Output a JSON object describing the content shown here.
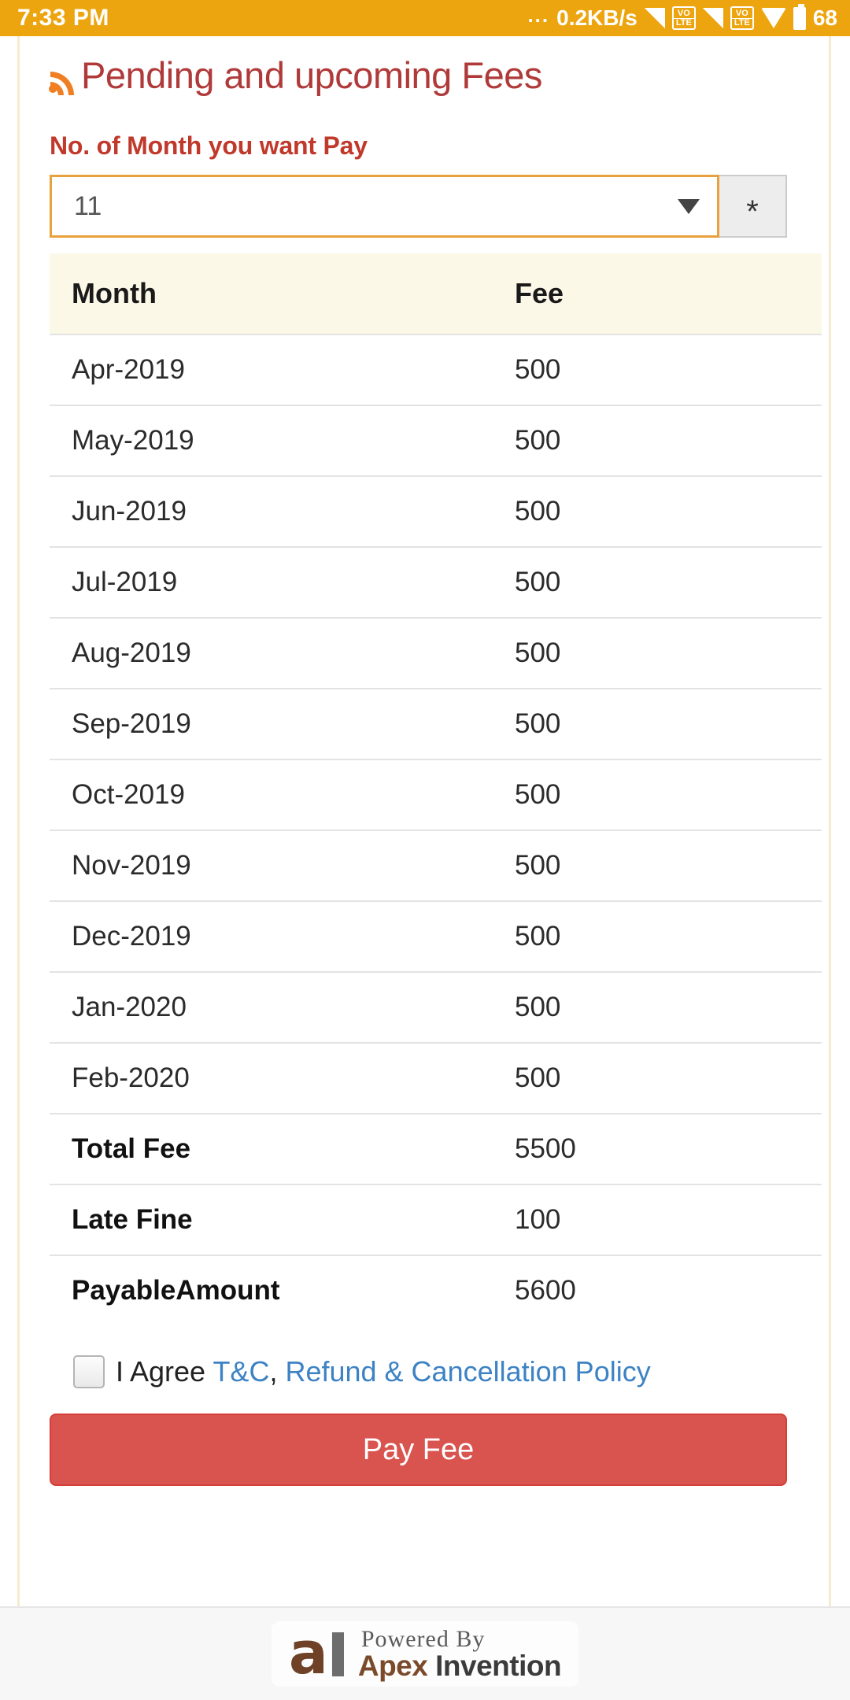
{
  "status_bar": {
    "time": "7:33 PM",
    "dots": "...",
    "data_rate": "0.2KB/s",
    "sim1_label_top": "VO",
    "sim1_label_bottom": "LTE",
    "sim2_label_top": "VO",
    "sim2_label_bottom": "LTE",
    "battery_percent": "68",
    "background_color": "#eda50f"
  },
  "header": {
    "icon": "rss-icon",
    "title": "Pending and upcoming Fees",
    "title_color": "#b03a3a",
    "icon_color": "#f07e22"
  },
  "form": {
    "label": "No. of Month you want Pay",
    "label_color": "#c0392b",
    "select_value": "11",
    "select_border_color": "#e8a13c",
    "caret_icon": "chevron-down-icon",
    "required_marker": "*"
  },
  "table": {
    "columns": [
      "Month",
      "Fee"
    ],
    "header_background": "#fbf8e8",
    "rows": [
      {
        "month": "Apr-2019",
        "fee": "500",
        "bold": false
      },
      {
        "month": "May-2019",
        "fee": "500",
        "bold": false
      },
      {
        "month": "Jun-2019",
        "fee": "500",
        "bold": false
      },
      {
        "month": "Jul-2019",
        "fee": "500",
        "bold": false
      },
      {
        "month": "Aug-2019",
        "fee": "500",
        "bold": false
      },
      {
        "month": "Sep-2019",
        "fee": "500",
        "bold": false
      },
      {
        "month": "Oct-2019",
        "fee": "500",
        "bold": false
      },
      {
        "month": "Nov-2019",
        "fee": "500",
        "bold": false
      },
      {
        "month": "Dec-2019",
        "fee": "500",
        "bold": false
      },
      {
        "month": "Jan-2020",
        "fee": "500",
        "bold": false
      },
      {
        "month": "Feb-2020",
        "fee": "500",
        "bold": false
      },
      {
        "month": "Total Fee",
        "fee": "5500",
        "bold": true
      },
      {
        "month": "Late Fine",
        "fee": "100",
        "bold": true
      },
      {
        "month": "PayableAmount",
        "fee": "5600",
        "bold": true
      }
    ]
  },
  "agreement": {
    "checked": false,
    "prefix": "I Agree ",
    "link_tc": "T&C",
    "separator": ", ",
    "link_policy": "Refund & Cancellation Policy",
    "link_color": "#3c82c4"
  },
  "actions": {
    "pay_label": "Pay Fee",
    "pay_color": "#d9534f"
  },
  "footer": {
    "logo_letter": "a",
    "powered_by": "Powered By",
    "brand_first": "Apex",
    "brand_second": " Invention"
  }
}
